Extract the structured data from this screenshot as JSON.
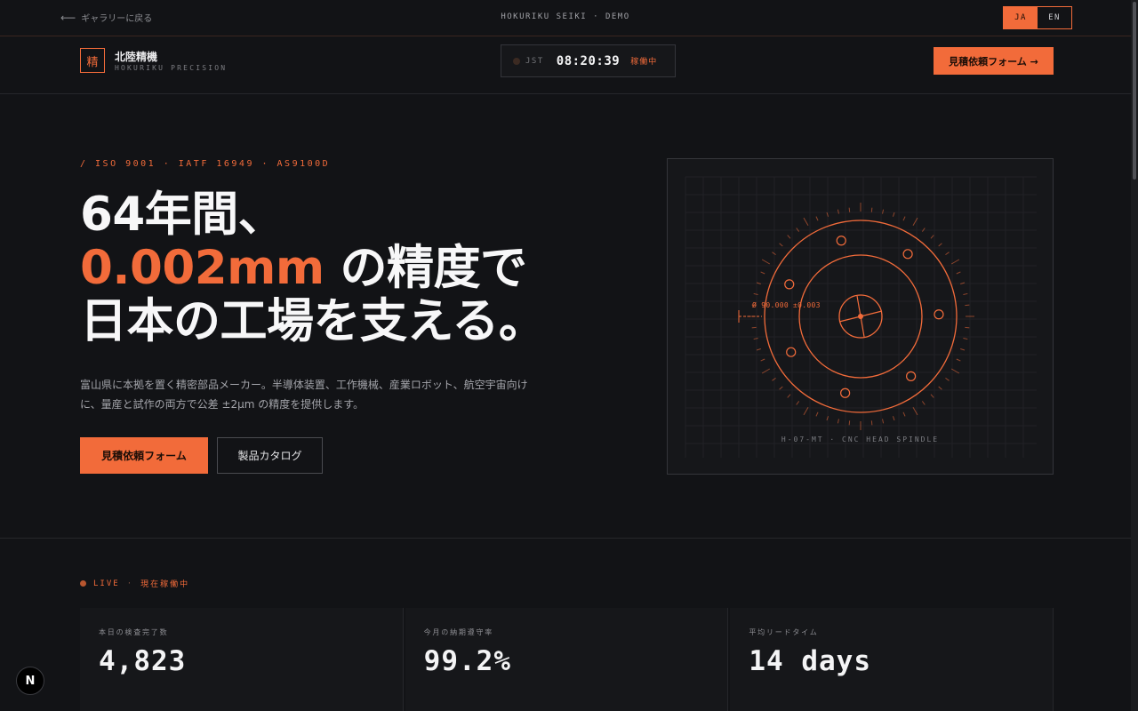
{
  "topbar": {
    "back_label": "ギャラリーに戻る",
    "demo_label": "HOKURIKU SEIKI · DEMO",
    "lang": {
      "ja": "JA",
      "en": "EN",
      "active": "JA"
    }
  },
  "header": {
    "logo_char": "精",
    "brand_name": "北陸精機",
    "brand_sub": "HOKURIKU PRECISION",
    "clock": {
      "tz": "JST",
      "time": "08:20:39",
      "status": "稼働中"
    },
    "cta_label": "見積依頼フォーム →"
  },
  "hero": {
    "certifications": "/ ISO 9001 · IATF 16949 · AS9100D",
    "title_line1": "64年間、",
    "title_accent": "0.002mm",
    "title_line2_rest": " の精度で",
    "title_line3": "日本の工場を支える。",
    "description": "富山県に本拠を置く精密部品メーカー。半導体装置、工作機械、産業ロボット、航空宇宙向けに、量産と試作の両方で公差 ±2μm の精度を提供します。",
    "primary_button": "見積依頼フォーム",
    "secondary_button": "製品カタログ"
  },
  "drawing": {
    "dimension_label": "Ø 90.000 ±0.003",
    "caption": "H-07-MT · CNC HEAD SPINDLE"
  },
  "live": {
    "label": "LIVE",
    "sub": "現在稼働中",
    "stats": [
      {
        "label": "本日の検査完了数",
        "value": "4,823"
      },
      {
        "label": "今月の納期遵守率",
        "value": "99.2%"
      },
      {
        "label": "平均リードタイム",
        "value": "14 days"
      }
    ]
  },
  "colors": {
    "accent": "#f26b3a",
    "background": "#121316",
    "panel": "#16171a"
  },
  "next_badge": "N"
}
